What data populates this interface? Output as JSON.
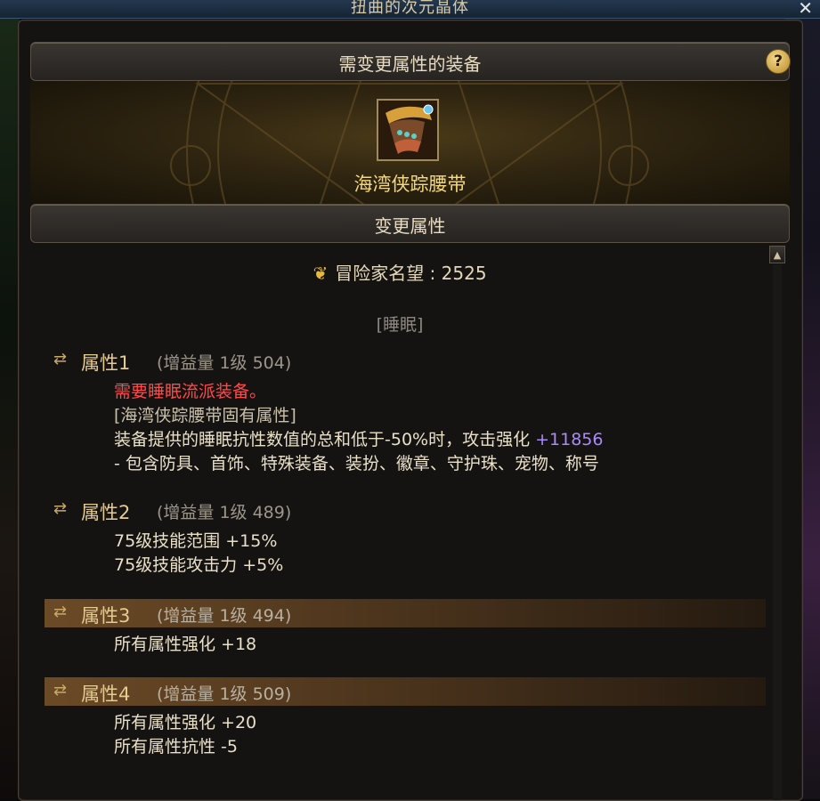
{
  "window_title": "扭曲的次元晶体",
  "close_label": "✕",
  "equip_section": {
    "label": "需变更属性的装备",
    "help_label": "?"
  },
  "item": {
    "name": "海湾侠踪腰带",
    "icon": "belt-icon"
  },
  "change_section": {
    "label": "变更属性"
  },
  "fame": {
    "label": "冒险家名望 : 2525",
    "icon": "fame-icon"
  },
  "tag": "[睡眠]",
  "attributes": [
    {
      "name": "属性1",
      "meta": "(增益量 1级 504)",
      "highlighted": false,
      "lines": [
        "需要睡眠流派装备。",
        "[海湾侠踪腰带固有属性]",
        "装备提供的睡眠抗性数值的总和低于-50%时，攻击强化",
        "- 包含防具、首饰、特殊装备、装扮、徽章、守护珠、宠物、称号"
      ],
      "value": "+11856"
    },
    {
      "name": "属性2",
      "meta": "(增益量 1级 489)",
      "highlighted": false,
      "lines": [
        "75级技能范围 +15%",
        "75级技能攻击力 +5%"
      ]
    },
    {
      "name": "属性3",
      "meta": "(增益量 1级 494)",
      "highlighted": true,
      "lines": [
        "所有属性强化 +18"
      ]
    },
    {
      "name": "属性4",
      "meta": "(增益量 1级 509)",
      "highlighted": true,
      "lines": [
        "所有属性强化 +20",
        "所有属性抗性 -5"
      ]
    }
  ],
  "colors": {
    "accent_gold": "#f5d97a",
    "warning_red": "#ff4a4a",
    "value_purple": "#a98af8"
  }
}
